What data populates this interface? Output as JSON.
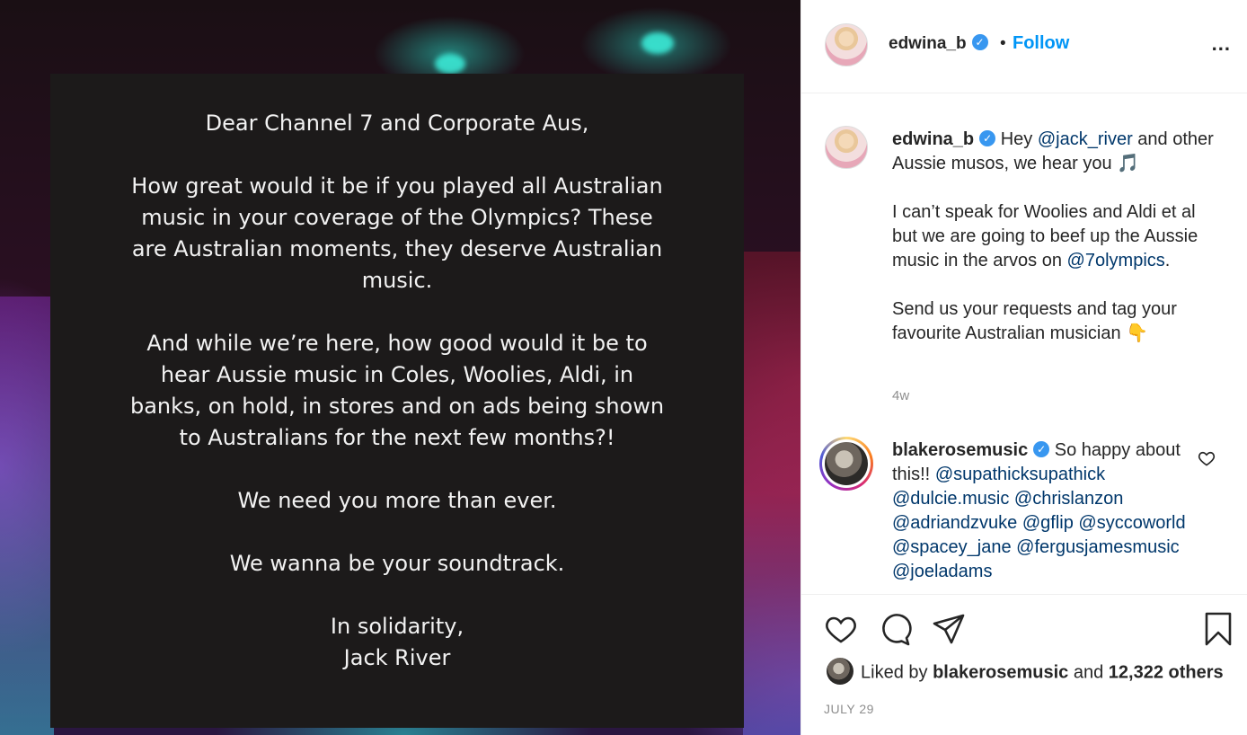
{
  "post_image": {
    "lines": [
      "Dear Channel 7 and Corporate Aus,",
      "How great would it be if you played all Australian music in your coverage of the Olympics? These are Australian moments, they deserve Australian music.",
      "And while we’re here, how good would it be to hear Aussie music in Coles, Woolies, Aldi, in banks, on hold, in stores and on ads being shown to Australians for the next few months?!",
      "We need you more than ever.",
      "We wanna be your soundtrack.",
      "In solidarity,",
      "Jack River"
    ]
  },
  "header": {
    "username": "edwina_b",
    "dot": "•",
    "follow_label": "Follow",
    "more_icon": "..."
  },
  "caption": {
    "username": "edwina_b",
    "text_1": "Hey",
    "mention_1": "@jack_river",
    "text_2": "and other Aussie musos, we hear you",
    "emoji_1": "🎵",
    "para_2_text": "I can’t speak for Woolies and Aldi et al but we are going to beef up the Aussie music in the arvos on",
    "mention_2": "@7olympics",
    "para_2_end": ".",
    "para_3_text": "Send us your requests and tag your favourite Australian musician",
    "emoji_2": "👇",
    "time": "4w"
  },
  "reply": {
    "username": "blakerosemusic",
    "text": "So happy about this!!",
    "mentions": [
      "@supathicksupathick",
      "@dulcie.music",
      "@chrislanzon",
      "@adriandzvuke",
      "@gflip",
      "@syccoworld",
      "@spacey_jane",
      "@fergusjamesmusic",
      "@joeladams"
    ]
  },
  "likes": {
    "prefix": "Liked by",
    "user": "blakerosemusic",
    "middle": "and",
    "count": "12,322 others"
  },
  "date": "JULY 29"
}
